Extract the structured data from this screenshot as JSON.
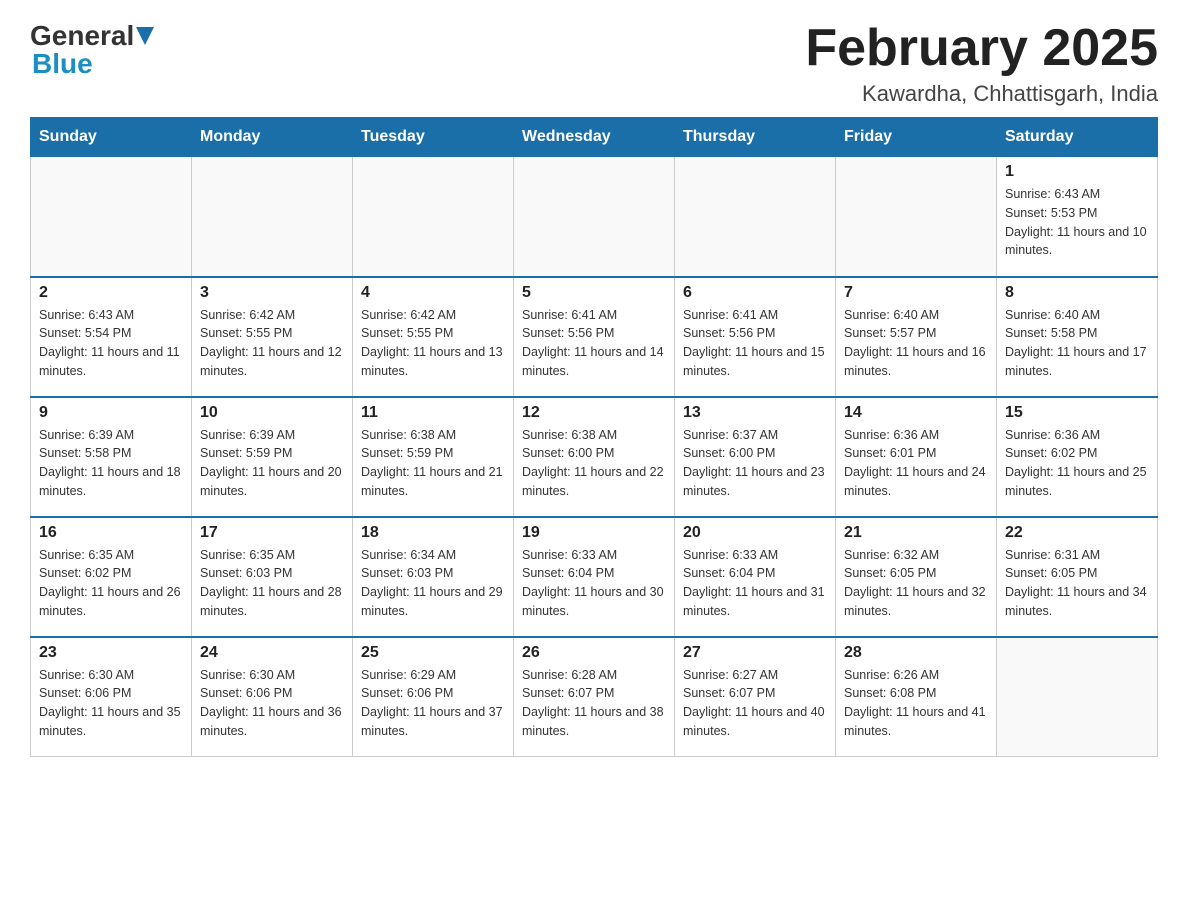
{
  "logo": {
    "general": "General",
    "blue": "Blue"
  },
  "title": "February 2025",
  "location": "Kawardha, Chhattisgarh, India",
  "weekdays": [
    "Sunday",
    "Monday",
    "Tuesday",
    "Wednesday",
    "Thursday",
    "Friday",
    "Saturday"
  ],
  "weeks": [
    [
      {
        "day": "",
        "info": ""
      },
      {
        "day": "",
        "info": ""
      },
      {
        "day": "",
        "info": ""
      },
      {
        "day": "",
        "info": ""
      },
      {
        "day": "",
        "info": ""
      },
      {
        "day": "",
        "info": ""
      },
      {
        "day": "1",
        "info": "Sunrise: 6:43 AM\nSunset: 5:53 PM\nDaylight: 11 hours and 10 minutes."
      }
    ],
    [
      {
        "day": "2",
        "info": "Sunrise: 6:43 AM\nSunset: 5:54 PM\nDaylight: 11 hours and 11 minutes."
      },
      {
        "day": "3",
        "info": "Sunrise: 6:42 AM\nSunset: 5:55 PM\nDaylight: 11 hours and 12 minutes."
      },
      {
        "day": "4",
        "info": "Sunrise: 6:42 AM\nSunset: 5:55 PM\nDaylight: 11 hours and 13 minutes."
      },
      {
        "day": "5",
        "info": "Sunrise: 6:41 AM\nSunset: 5:56 PM\nDaylight: 11 hours and 14 minutes."
      },
      {
        "day": "6",
        "info": "Sunrise: 6:41 AM\nSunset: 5:56 PM\nDaylight: 11 hours and 15 minutes."
      },
      {
        "day": "7",
        "info": "Sunrise: 6:40 AM\nSunset: 5:57 PM\nDaylight: 11 hours and 16 minutes."
      },
      {
        "day": "8",
        "info": "Sunrise: 6:40 AM\nSunset: 5:58 PM\nDaylight: 11 hours and 17 minutes."
      }
    ],
    [
      {
        "day": "9",
        "info": "Sunrise: 6:39 AM\nSunset: 5:58 PM\nDaylight: 11 hours and 18 minutes."
      },
      {
        "day": "10",
        "info": "Sunrise: 6:39 AM\nSunset: 5:59 PM\nDaylight: 11 hours and 20 minutes."
      },
      {
        "day": "11",
        "info": "Sunrise: 6:38 AM\nSunset: 5:59 PM\nDaylight: 11 hours and 21 minutes."
      },
      {
        "day": "12",
        "info": "Sunrise: 6:38 AM\nSunset: 6:00 PM\nDaylight: 11 hours and 22 minutes."
      },
      {
        "day": "13",
        "info": "Sunrise: 6:37 AM\nSunset: 6:00 PM\nDaylight: 11 hours and 23 minutes."
      },
      {
        "day": "14",
        "info": "Sunrise: 6:36 AM\nSunset: 6:01 PM\nDaylight: 11 hours and 24 minutes."
      },
      {
        "day": "15",
        "info": "Sunrise: 6:36 AM\nSunset: 6:02 PM\nDaylight: 11 hours and 25 minutes."
      }
    ],
    [
      {
        "day": "16",
        "info": "Sunrise: 6:35 AM\nSunset: 6:02 PM\nDaylight: 11 hours and 26 minutes."
      },
      {
        "day": "17",
        "info": "Sunrise: 6:35 AM\nSunset: 6:03 PM\nDaylight: 11 hours and 28 minutes."
      },
      {
        "day": "18",
        "info": "Sunrise: 6:34 AM\nSunset: 6:03 PM\nDaylight: 11 hours and 29 minutes."
      },
      {
        "day": "19",
        "info": "Sunrise: 6:33 AM\nSunset: 6:04 PM\nDaylight: 11 hours and 30 minutes."
      },
      {
        "day": "20",
        "info": "Sunrise: 6:33 AM\nSunset: 6:04 PM\nDaylight: 11 hours and 31 minutes."
      },
      {
        "day": "21",
        "info": "Sunrise: 6:32 AM\nSunset: 6:05 PM\nDaylight: 11 hours and 32 minutes."
      },
      {
        "day": "22",
        "info": "Sunrise: 6:31 AM\nSunset: 6:05 PM\nDaylight: 11 hours and 34 minutes."
      }
    ],
    [
      {
        "day": "23",
        "info": "Sunrise: 6:30 AM\nSunset: 6:06 PM\nDaylight: 11 hours and 35 minutes."
      },
      {
        "day": "24",
        "info": "Sunrise: 6:30 AM\nSunset: 6:06 PM\nDaylight: 11 hours and 36 minutes."
      },
      {
        "day": "25",
        "info": "Sunrise: 6:29 AM\nSunset: 6:06 PM\nDaylight: 11 hours and 37 minutes."
      },
      {
        "day": "26",
        "info": "Sunrise: 6:28 AM\nSunset: 6:07 PM\nDaylight: 11 hours and 38 minutes."
      },
      {
        "day": "27",
        "info": "Sunrise: 6:27 AM\nSunset: 6:07 PM\nDaylight: 11 hours and 40 minutes."
      },
      {
        "day": "28",
        "info": "Sunrise: 6:26 AM\nSunset: 6:08 PM\nDaylight: 11 hours and 41 minutes."
      },
      {
        "day": "",
        "info": ""
      }
    ]
  ]
}
